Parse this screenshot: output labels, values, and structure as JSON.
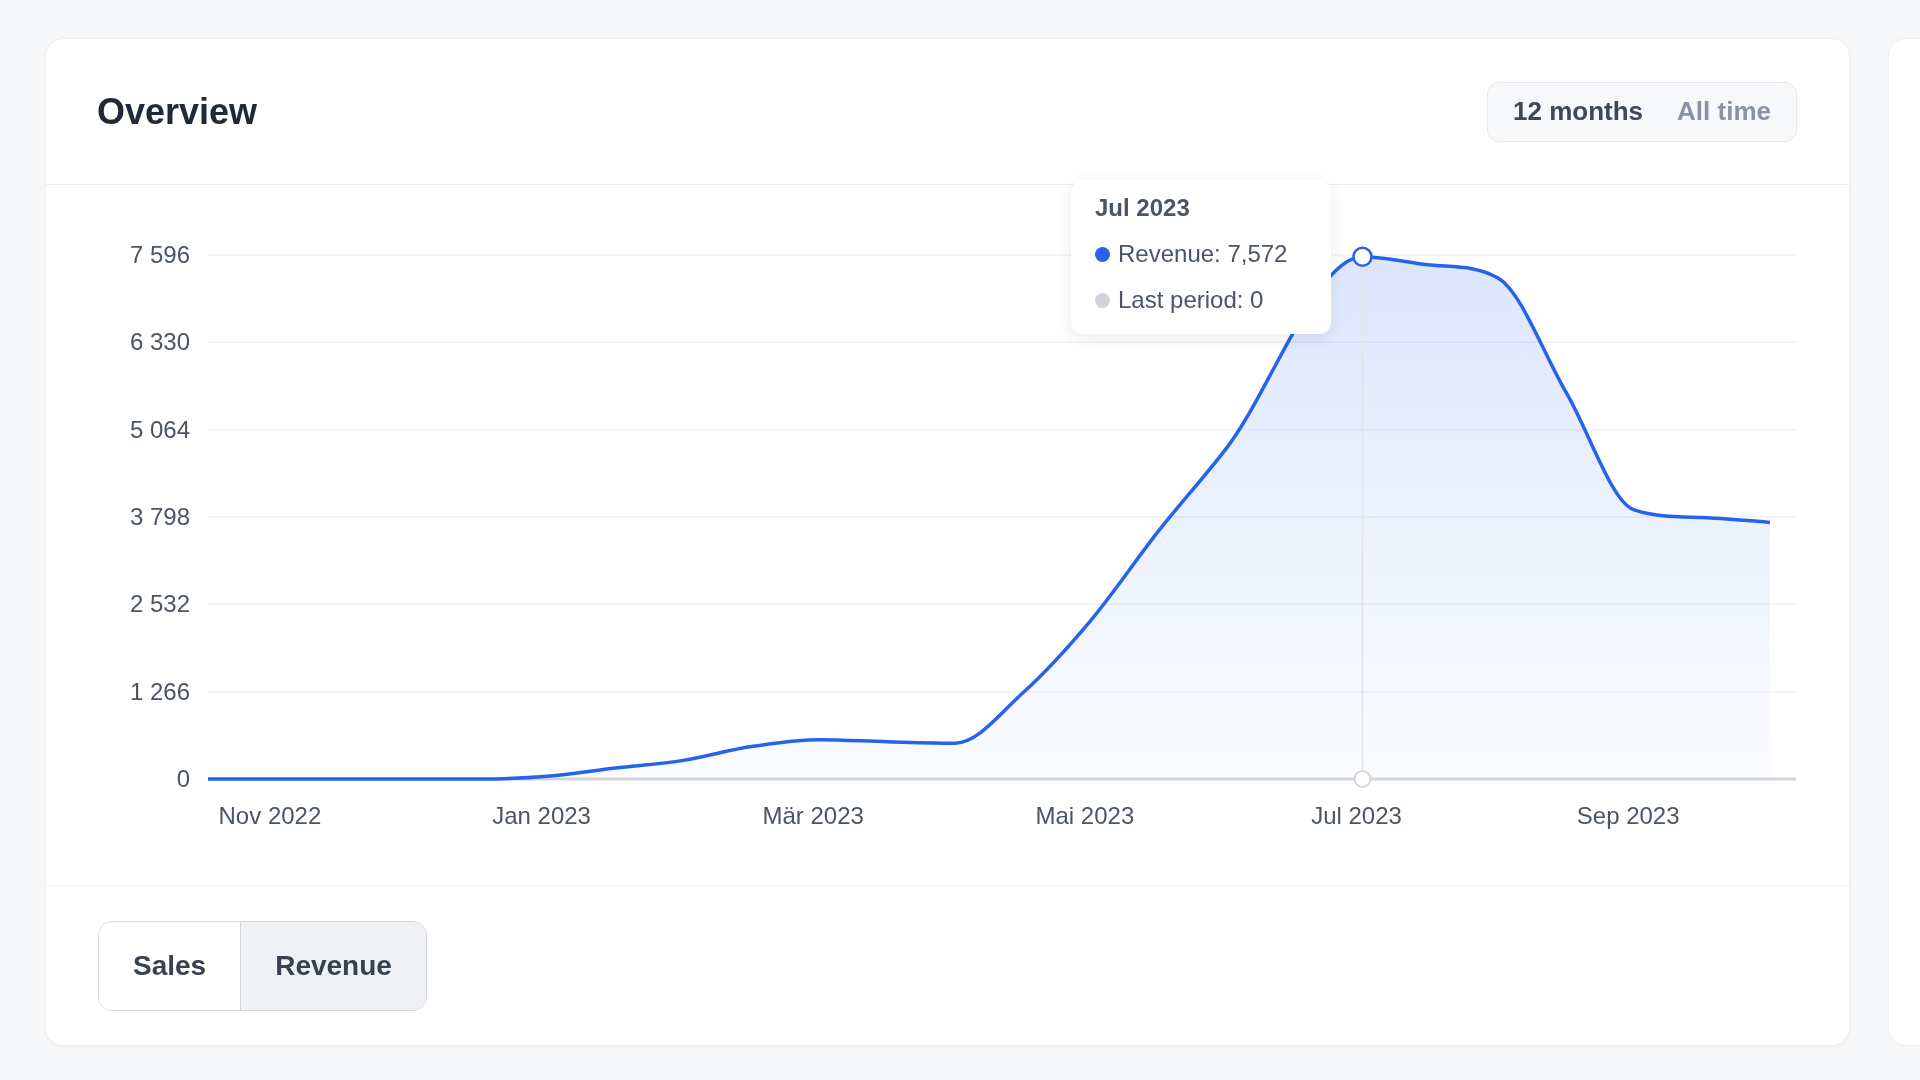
{
  "overview": {
    "title": "Overview",
    "ranges": [
      {
        "label": "12 months",
        "selected": true
      },
      {
        "label": "All time",
        "selected": false
      }
    ],
    "chart_data": {
      "type": "area",
      "categories": [
        null,
        "Nov 2022",
        null,
        null,
        null,
        "Jan 2023",
        null,
        null,
        null,
        "Mär 2023",
        null,
        null,
        null,
        "Mai 2023",
        null,
        null,
        null,
        "Jul 2023",
        null,
        null,
        null,
        "Sep 2023",
        null,
        null
      ],
      "series": [
        {
          "color": "#2563eb",
          "values": [
            0,
            0,
            0,
            0,
            0,
            40,
            160,
            270,
            470,
            570,
            540,
            520,
            1250,
            2300,
            3600,
            4800,
            null,
            7572,
            7450,
            7260,
            5600,
            3900,
            3790,
            3720
          ]
        }
      ],
      "ylim": [
        0,
        7596
      ],
      "grid": true,
      "yticks": [
        {
          "value": 0,
          "label": "0"
        },
        {
          "value": 1266,
          "label": "1 266"
        },
        {
          "value": 2532,
          "label": "2 532"
        },
        {
          "value": 3798,
          "label": "3 798"
        },
        {
          "value": 5064,
          "label": "5 064"
        },
        {
          "value": 6330,
          "label": "6 330"
        },
        {
          "value": 7596,
          "label": "7 596"
        }
      ]
    },
    "tooltip": {
      "title": "Jul 2023",
      "items": [
        {
          "label": "Revenue: 7,572",
          "color": "#2563eb"
        },
        {
          "label": "Last period: 0",
          "color": "#d1d5db"
        }
      ]
    },
    "metrics": [
      {
        "label": "Sales",
        "selected": false
      },
      {
        "label": "Revenue",
        "selected": true
      }
    ]
  }
}
